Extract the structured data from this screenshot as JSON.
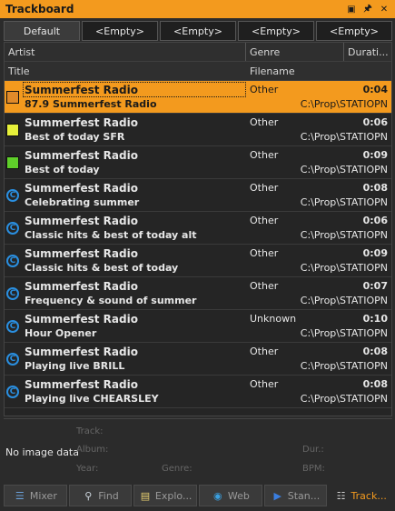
{
  "window": {
    "title": "Trackboard"
  },
  "tabs": [
    "Default",
    "<Empty>",
    "<Empty>",
    "<Empty>",
    "<Empty>"
  ],
  "columns": {
    "artist": "Artist",
    "genre": "Genre",
    "duration": "Durati...",
    "title": "Title",
    "filename": "Filename"
  },
  "rows": [
    {
      "artist": "Summerfest Radio",
      "title": "87.9 Summerfest Radio",
      "genre": "Other",
      "duration": "0:04",
      "filename": "C:\\Prop\\STATIOPN",
      "icon": "orange-square-icon",
      "color": "#e08a2a",
      "selected": true
    },
    {
      "artist": "Summerfest Radio",
      "title": "Best of today SFR",
      "genre": "Other",
      "duration": "0:06",
      "filename": "C:\\Prop\\STATIOPN",
      "icon": "yellow-square-icon",
      "color": "#e6f03a"
    },
    {
      "artist": "Summerfest Radio",
      "title": "Best of today",
      "genre": "Other",
      "duration": "0:09",
      "filename": "C:\\Prop\\STATIOPN",
      "icon": "green-square-icon",
      "color": "#5fcf2a"
    },
    {
      "artist": "Summerfest Radio",
      "title": "Celebrating summer",
      "genre": "Other",
      "duration": "0:08",
      "filename": "C:\\Prop\\STATIOPN",
      "icon": "blue-circle-icon"
    },
    {
      "artist": "Summerfest Radio",
      "title": "Classic hits & best of today alt",
      "genre": "Other",
      "duration": "0:06",
      "filename": "C:\\Prop\\STATIOPN",
      "icon": "blue-circle-icon"
    },
    {
      "artist": "Summerfest Radio",
      "title": "Classic hits & best of today",
      "genre": "Other",
      "duration": "0:09",
      "filename": "C:\\Prop\\STATIOPN",
      "icon": "blue-circle-icon"
    },
    {
      "artist": "Summerfest Radio",
      "title": "Frequency & sound of summer",
      "genre": "Other",
      "duration": "0:07",
      "filename": "C:\\Prop\\STATIOPN",
      "icon": "blue-circle-icon"
    },
    {
      "artist": "Summerfest Radio",
      "title": "Hour Opener",
      "genre": "Unknown",
      "duration": "0:10",
      "filename": "C:\\Prop\\STATIOPN",
      "icon": "blue-circle-icon"
    },
    {
      "artist": "Summerfest Radio",
      "title": "Playing live BRILL",
      "genre": "Other",
      "duration": "0:08",
      "filename": "C:\\Prop\\STATIOPN",
      "icon": "blue-circle-icon"
    },
    {
      "artist": "Summerfest Radio",
      "title": "Playing live CHEARSLEY",
      "genre": "Other",
      "duration": "0:08",
      "filename": "C:\\Prop\\STATIOPN",
      "icon": "blue-circle-icon"
    }
  ],
  "info": {
    "no_image": "No image data",
    "track": "Track:",
    "album": "Album:",
    "year": "Year:",
    "genre": "Genre:",
    "dur": "Dur.:",
    "bpm": "BPM:"
  },
  "bottom_tabs": [
    {
      "label": "Mixer",
      "icon": "mixer-icon"
    },
    {
      "label": "Find",
      "icon": "magnifier-icon"
    },
    {
      "label": "Explo...",
      "icon": "explorer-icon"
    },
    {
      "label": "Web",
      "icon": "globe-icon"
    },
    {
      "label": "Stan...",
      "icon": "play-icon"
    },
    {
      "label": "Track...",
      "icon": "trackboard-icon",
      "active": true
    }
  ],
  "colors": {
    "accent": "#f39a1e",
    "selection": "#f39a1e",
    "stream_icon": "#2a8fe0"
  }
}
